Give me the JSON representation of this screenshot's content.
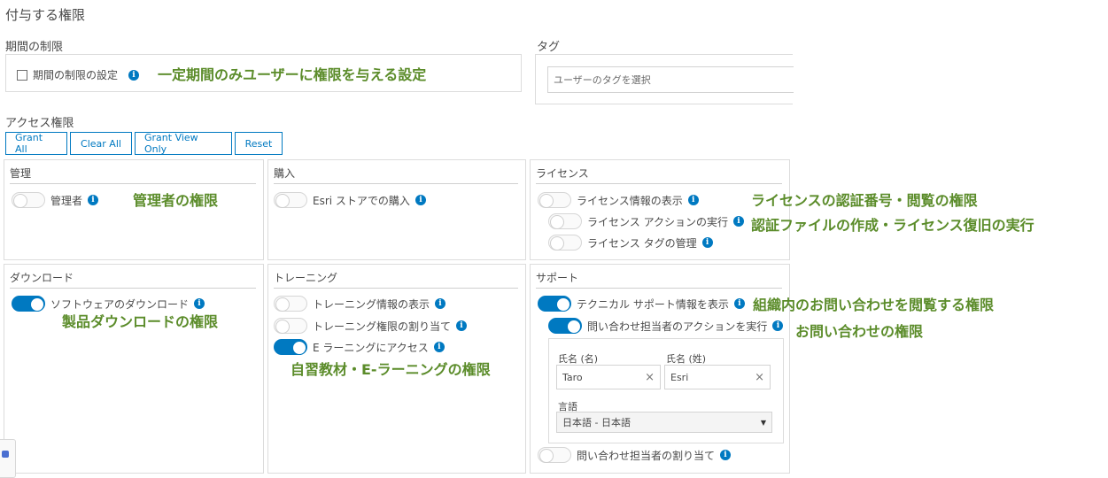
{
  "page_title": "付与する権限",
  "period": {
    "section_label": "期間の制限",
    "checkbox_label": "期間の制限の設定",
    "annotation": "一定期間のみユーザーに権限を与える設定"
  },
  "tags": {
    "section_label": "タグ",
    "placeholder": "ユーザーのタグを選択"
  },
  "access": {
    "section_label": "アクセス権限",
    "buttons": [
      "Grant All",
      "Clear All",
      "Grant View Only",
      "Reset"
    ]
  },
  "cards": {
    "admin": {
      "title": "管理",
      "items": [
        {
          "label": "管理者",
          "on": false
        }
      ],
      "annotation": "管理者の権限"
    },
    "purchase": {
      "title": "購入",
      "items": [
        {
          "label": "Esri ストアでの購入",
          "on": false
        }
      ]
    },
    "license": {
      "title": "ライセンス",
      "items": [
        {
          "label": "ライセンス情報の表示",
          "on": false
        },
        {
          "label": "ライセンス アクションの実行",
          "on": false
        },
        {
          "label": "ライセンス タグの管理",
          "on": false
        }
      ],
      "annotation1": "ライセンスの認証番号・閲覧の権限",
      "annotation2": "認証ファイルの作成・ライセンス復旧の実行"
    },
    "download": {
      "title": "ダウンロード",
      "items": [
        {
          "label": "ソフトウェアのダウンロード",
          "on": true
        }
      ],
      "annotation": "製品ダウンロードの権限"
    },
    "training": {
      "title": "トレーニング",
      "items": [
        {
          "label": "トレーニング情報の表示",
          "on": false
        },
        {
          "label": "トレーニング権限の割り当て",
          "on": false
        },
        {
          "label": "E ラーニングにアクセス",
          "on": true
        }
      ],
      "annotation": "自習教材・E-ラーニングの権限"
    },
    "support": {
      "title": "サポート",
      "items": [
        {
          "label": "テクニカル サポート情報を表示",
          "on": true
        },
        {
          "label": "問い合わせ担当者のアクションを実行",
          "on": true
        },
        {
          "label": "問い合わせ担当者の割り当て",
          "on": false
        }
      ],
      "annotation1": "組織内のお問い合わせを閲覧する権限",
      "annotation2": "お問い合わせの権限",
      "form": {
        "first_name_label": "氏名 (名)",
        "first_name_value": "Taro",
        "last_name_label": "氏名 (姓)",
        "last_name_value": "Esri",
        "language_label": "言語",
        "language_value": "日本語 - 日本語"
      }
    }
  },
  "icons": {
    "info": "i",
    "clear": "×",
    "dropdown": "▼"
  },
  "colors": {
    "accent": "#0079c1",
    "annotation": "#5b8c2a"
  }
}
